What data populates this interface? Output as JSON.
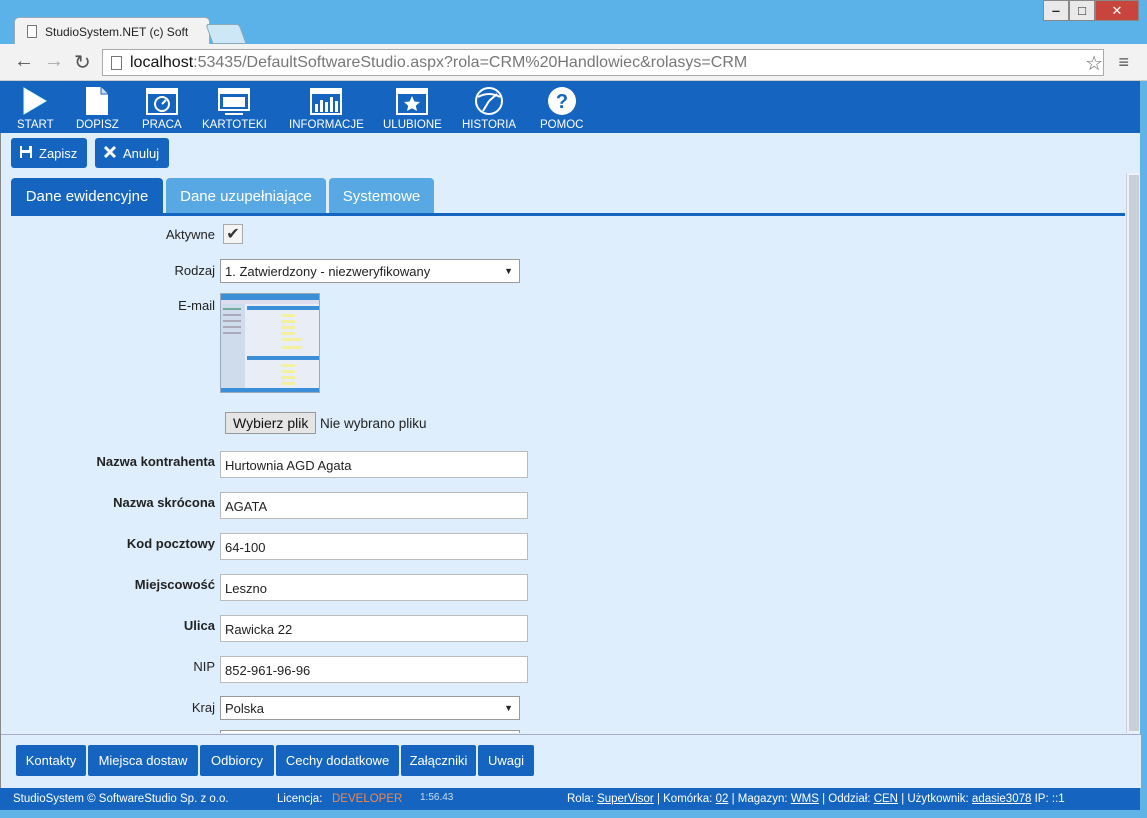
{
  "browser": {
    "tab_title": "StudioSystem.NET (c) Soft",
    "url_host": "localhost",
    "url_rest": ":53435/DefaultSoftwareStudio.aspx?rola=CRM%20Handlowiec&rolasys=CRM",
    "win_min": "‒",
    "win_max": "□",
    "win_close": "✕",
    "back_icon": "←",
    "forward_icon": "→",
    "reload_icon": "↻",
    "star_icon": "☆",
    "menu_icon": "≡"
  },
  "toolbar": {
    "items": [
      {
        "label": "START",
        "icon": "play-icon"
      },
      {
        "label": "DOPISZ",
        "icon": "document-icon"
      },
      {
        "label": "PRACA",
        "icon": "dashboard-icon"
      },
      {
        "label": "KARTOTEKI",
        "icon": "monitor-icon"
      },
      {
        "label": "INFORMACJE",
        "icon": "bar-chart-icon"
      },
      {
        "label": "ULUBIONE",
        "icon": "star-icon"
      },
      {
        "label": "HISTORIA",
        "icon": "history-icon"
      },
      {
        "label": "POMOC",
        "icon": "help-icon"
      }
    ]
  },
  "actions": {
    "save_label": "Zapisz",
    "cancel_label": "Anuluj"
  },
  "tabs": [
    {
      "label": "Dane ewidencyjne",
      "active": true
    },
    {
      "label": "Dane uzupełniające",
      "active": false
    },
    {
      "label": "Systemowe",
      "active": false
    }
  ],
  "form": {
    "aktywne_label": "Aktywne",
    "aktywne_value": true,
    "aktywne_mark": "✔",
    "rodzaj_label": "Rodzaj",
    "rodzaj_value": "1. Zatwierdzony - niezweryfikowany",
    "email_label": "E-mail",
    "file_button": "Wybierz plik",
    "file_status": "Nie wybrano pliku",
    "nazwa_label": "Nazwa kontrahenta",
    "nazwa_value": "Hurtownia AGD Agata",
    "skrot_label": "Nazwa skrócona",
    "skrot_value": "AGATA",
    "kod_label": "Kod pocztowy",
    "kod_value": "64-100",
    "miejsc_label": "Miejscowość",
    "miejsc_value": "Leszno",
    "ulica_label": "Ulica",
    "ulica_value": "Rawicka 22",
    "nip_label": "NIP",
    "nip_value": "852-961-96-96",
    "kraj_label": "Kraj",
    "kraj_value": "Polska"
  },
  "bottom_buttons": [
    "Kontakty",
    "Miejsca dostaw",
    "Odbiorcy",
    "Cechy dodatkowe",
    "Załączniki",
    "Uwagi"
  ],
  "status": {
    "copyright": "StudioSystem © SoftwareStudio Sp. z o.o.",
    "license_label": "Licencja:",
    "license_value": "DEVELOPER",
    "time": "1:56.43",
    "rola_label": "Rola:",
    "rola_value": "SuperVisor",
    "komorka_label": "| Komórka:",
    "komorka_value": "02",
    "magazyn_label": "| Magazyn:",
    "magazyn_value": "WMS",
    "oddzial_label": "| Oddział:",
    "oddzial_value": "CEN",
    "uzytkownik_label": "| Użytkownik:",
    "uzytkownik_value": "adasie3078",
    "ip_label": "IP:",
    "ip_value": "::1"
  },
  "colors": {
    "brand_blue": "#1565c0",
    "tab_inactive": "#58a8e3",
    "content_bg": "#dfeefc",
    "license_orange": "#f0864a"
  }
}
